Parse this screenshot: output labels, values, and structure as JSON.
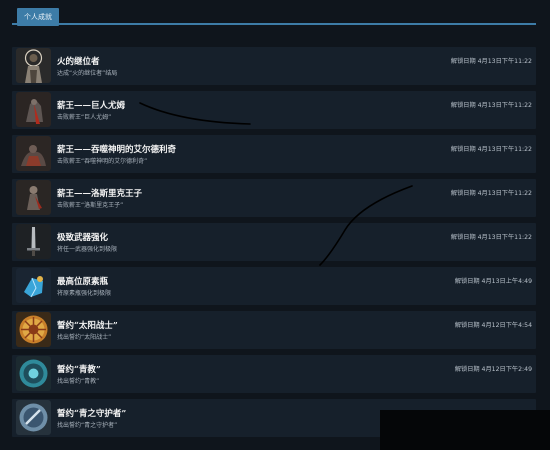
{
  "tab": {
    "label": "个人成就"
  },
  "achievements": [
    {
      "icon": "bonfire-knight-icon",
      "title": "火的继位者",
      "desc": "达成“火的继位者”结局",
      "date": "解锁日期 4月13日下午11:22"
    },
    {
      "icon": "giant-king-icon",
      "title": "薪王——巨人尤姆",
      "desc": "击败薪王“巨人尤姆”",
      "date": "解锁日期 4月13日下午11:22"
    },
    {
      "icon": "aldrich-icon",
      "title": "薪王——吞噬神明的艾尔德利奇",
      "desc": "击败薪王“吞噬神明的艾尔德利奇”",
      "date": "解锁日期 4月13日下午11:22"
    },
    {
      "icon": "lothric-prince-icon",
      "title": "薪王——洛斯里克王子",
      "desc": "击败薪王“洛斯里克王子”",
      "date": "解锁日期 4月13日下午11:22"
    },
    {
      "icon": "sword-icon",
      "title": "极致武器强化",
      "desc": "将任一武器强化到极限",
      "date": "解锁日期 4月13日下午11:22"
    },
    {
      "icon": "titanite-icon",
      "title": "最高位原素瓶",
      "desc": "将原素瓶强化到极限",
      "date": "解锁日期 4月13日上午4:49"
    },
    {
      "icon": "sun-emblem-icon",
      "title": "誓约“太阳战士”",
      "desc": "找出誓约“太阳战士”",
      "date": "解锁日期 4月12日下午4:54"
    },
    {
      "icon": "blue-ring-icon",
      "title": "誓约“青教”",
      "desc": "找出誓约“青教”",
      "date": "解锁日期 4月12日下午2:49"
    },
    {
      "icon": "blue-sentinel-icon",
      "title": "誓约“青之守护者”",
      "desc": "找出誓约“青之守护者”",
      "date": ""
    }
  ]
}
